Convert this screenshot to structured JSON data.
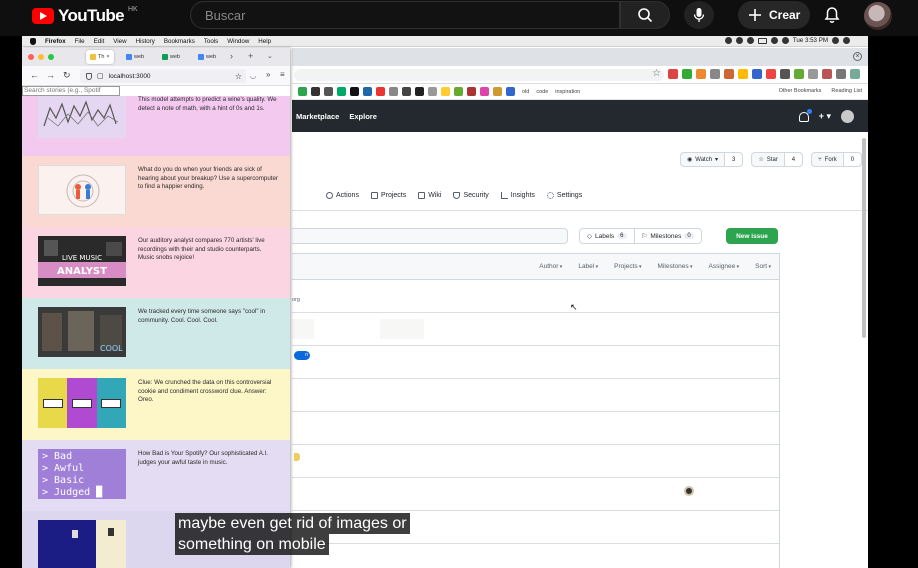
{
  "youtube": {
    "logo_text": "YouTube",
    "logo_sup": "HK",
    "search_placeholder": "Buscar",
    "create_label": "Crear"
  },
  "macos": {
    "menubar": [
      "Firefox",
      "File",
      "Edit",
      "View",
      "History",
      "Bookmarks",
      "Tools",
      "Window",
      "Help"
    ],
    "clock": "Tue 3:53 PM"
  },
  "firefox": {
    "tabs": [
      {
        "label": "Th"
      },
      {
        "label": "web"
      },
      {
        "label": "web"
      },
      {
        "label": "web"
      }
    ],
    "url": "localhost:3000",
    "search_placeholder": "Search stories (e.g., Spotif",
    "stories": [
      {
        "text": "This model attempts to predict a wine's quality. We detect a note of math, with a hint of 0s and 1s.",
        "bg": "#f3c9f0"
      },
      {
        "text": "What do you do when your friends are sick of hearing about your breakup? Use a supercomputer to find a happier ending.",
        "bg": "#fbd9d3"
      },
      {
        "text": "Our auditory analyst compares 770 artists' live recordings with their and studio counterparts. Music snobs rejoice!",
        "bg": "#fbd5e1"
      },
      {
        "text": "We tracked every time someone says \"cool\" in community. Cool. Cool. Cool.",
        "bg": "#cfe9e8"
      },
      {
        "text": "Clue: We crunched the data on this controversial cookie and condiment crossword clue. Answer: Oreo.",
        "bg": "#fdf6c6"
      },
      {
        "text": "How Bad is Your Spotify? Our sophisticated A.I. judges your awful taste in music.",
        "bg": "#e4dcf2"
      },
      {
        "text": "",
        "bg": "#dcd6ee"
      }
    ],
    "thumb_texts": {
      "live": "LIVE MUSIC",
      "live2": "ANALYST",
      "cool": "COOL",
      "spotify": [
        "> Bad",
        "> Awful",
        "> Basic",
        "> Judged █"
      ]
    }
  },
  "github": {
    "header_links": [
      "Marketplace",
      "Explore"
    ],
    "bookmarks": [
      "old",
      "code",
      "inspiration",
      "Other Bookmarks",
      "Reading List"
    ],
    "repo_actions": [
      {
        "label": "Watch",
        "count": "3"
      },
      {
        "label": "Star",
        "count": "4"
      },
      {
        "label": "Fork",
        "count": "0"
      }
    ],
    "tabs": [
      "Actions",
      "Projects",
      "Wiki",
      "Security",
      "Insights",
      "Settings"
    ],
    "labels": {
      "label": "Labels",
      "count": "6"
    },
    "milestones": {
      "label": "Milestones",
      "count": "0"
    },
    "new_issue": "New issue",
    "filters": [
      "Author",
      "Label",
      "Projects",
      "Milestones",
      "Assignee",
      "Sort"
    ],
    "row_meta": "org",
    "pill": "n"
  },
  "caption": [
    "maybe even get rid of images or",
    "something on mobile"
  ],
  "colors": {
    "yt_red": "#ff0000",
    "gh_header": "#24292f",
    "gh_green": "#2da44e",
    "gh_blue": "#0969da"
  }
}
